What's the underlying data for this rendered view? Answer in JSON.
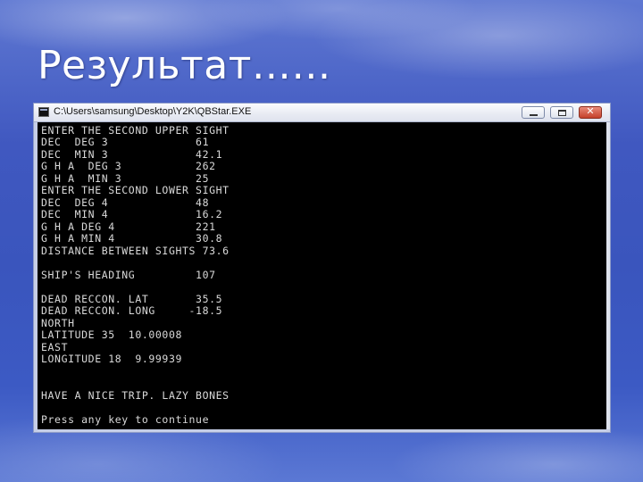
{
  "slide": {
    "title": "Результат……"
  },
  "window": {
    "title": "C:\\Users\\samsung\\Desktop\\Y2K\\QBStar.EXE"
  },
  "console": {
    "lines": [
      "ENTER THE SECOND UPPER SIGHT",
      "DEC  DEG 3             61",
      "DEC  MIN 3             42.1",
      "G H A  DEG 3           262",
      "G H A  MIN 3           25",
      "ENTER THE SECOND LOWER SIGHT",
      "DEC  DEG 4             48",
      "DEC  MIN 4             16.2",
      "G H A DEG 4            221",
      "G H A MIN 4            30.8",
      "DISTANCE BETWEEN SIGHTS 73.6",
      "",
      "SHIP'S HEADING         107",
      "",
      "DEAD RECCON. LAT       35.5",
      "DEAD RECCON. LONG     -18.5",
      "NORTH",
      "LATITUDE 35  10.00008",
      "EAST",
      "LONGITUDE 18  9.99939",
      "",
      "",
      "HAVE A NICE TRIP. LAZY BONES",
      "",
      "Press any key to continue"
    ]
  }
}
